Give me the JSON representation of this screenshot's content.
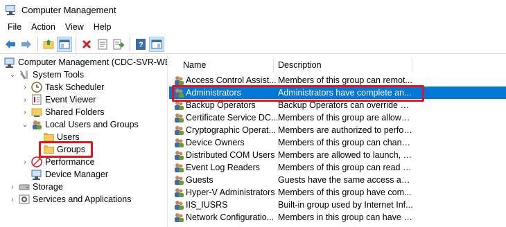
{
  "window": {
    "title": "Computer Management"
  },
  "menu": [
    "File",
    "Action",
    "View",
    "Help"
  ],
  "tree": {
    "root": "Computer Management (CDC-SVR-WEB",
    "system_tools": "System Tools",
    "task_scheduler": "Task Scheduler",
    "event_viewer": "Event Viewer",
    "shared_folders": "Shared Folders",
    "local_users_groups": "Local Users and Groups",
    "users": "Users",
    "groups": "Groups",
    "performance": "Performance",
    "device_manager": "Device Manager",
    "storage": "Storage",
    "services_apps": "Services and Applications"
  },
  "list": {
    "columns": {
      "name": "Name",
      "description": "Description"
    },
    "rows": [
      {
        "name": "Access Control Assist...",
        "description": "Members of this group can remot..."
      },
      {
        "name": "Administrators",
        "description": "Administrators have complete an..."
      },
      {
        "name": "Backup Operators",
        "description": "Backup Operators can override se..."
      },
      {
        "name": "Certificate Service DC...",
        "description": "Members of this group are allowe..."
      },
      {
        "name": "Cryptographic Operat...",
        "description": "Members are authorized to perfor..."
      },
      {
        "name": "Device Owners",
        "description": "Members of this group can chang..."
      },
      {
        "name": "Distributed COM Users",
        "description": "Members are allowed to launch, a..."
      },
      {
        "name": "Event Log Readers",
        "description": "Members of this group can read e..."
      },
      {
        "name": "Guests",
        "description": "Guests have the same access as m..."
      },
      {
        "name": "Hyper-V Administrators",
        "description": "Members of this group have com..."
      },
      {
        "name": "IIS_IUSRS",
        "description": "Built-in group used by Internet Inf..."
      },
      {
        "name": "Network Configuratio...",
        "description": "Members in this group can have s..."
      }
    ]
  },
  "colors": {
    "selection": "#0078d7",
    "highlight_box": "#e8121a"
  }
}
